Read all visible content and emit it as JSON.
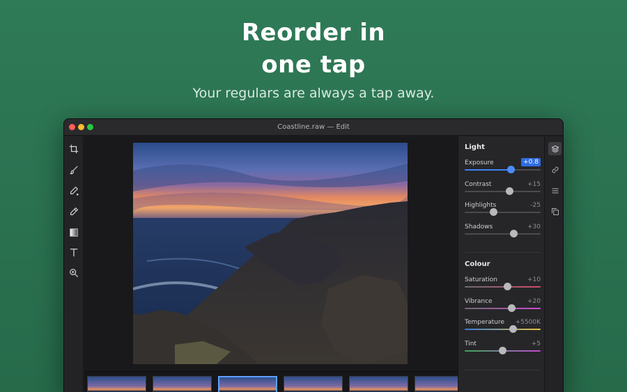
{
  "hero": {
    "headline_line1": "Reorder in",
    "headline_line2": "one tap",
    "subheadline": "Your regulars are always a tap away."
  },
  "window": {
    "title": "Coastline.raw — Edit"
  },
  "tools": [
    {
      "name": "crop-icon"
    },
    {
      "name": "brush-icon"
    },
    {
      "name": "pen-icon"
    },
    {
      "name": "healing-icon"
    },
    {
      "name": "gradient-icon"
    },
    {
      "name": "text-icon"
    },
    {
      "name": "zoom-icon"
    }
  ],
  "panel": {
    "light_title": "Light",
    "light": [
      {
        "label": "Exposure",
        "value": "+0.8",
        "position": 0.61,
        "active": true
      },
      {
        "label": "Contrast",
        "value": "+15",
        "position": 0.59
      },
      {
        "label": "Highlights",
        "value": "-25",
        "position": 0.38
      },
      {
        "label": "Shadows",
        "value": "+30",
        "position": 0.65
      }
    ],
    "colour_title": "Colour",
    "colour": [
      {
        "label": "Saturation",
        "value": "+10",
        "position": 0.56,
        "track": "saturation"
      },
      {
        "label": "Vibrance",
        "value": "+20",
        "position": 0.62,
        "track": "vibrance"
      },
      {
        "label": "Temperature",
        "value": "+5500K",
        "position": 0.64,
        "track": "temperature"
      },
      {
        "label": "Tint",
        "value": "+5",
        "position": 0.5,
        "track": "tint"
      }
    ]
  },
  "rail": [
    {
      "name": "layers-icon",
      "active": true
    },
    {
      "name": "link-icon"
    },
    {
      "name": "list-icon"
    },
    {
      "name": "copy-icon"
    }
  ],
  "filmstrip": {
    "count": 6,
    "selected_index": 2
  },
  "colors": {
    "background": "#2f7a57",
    "accent": "#3b82f6",
    "window": "#1e1e20"
  }
}
